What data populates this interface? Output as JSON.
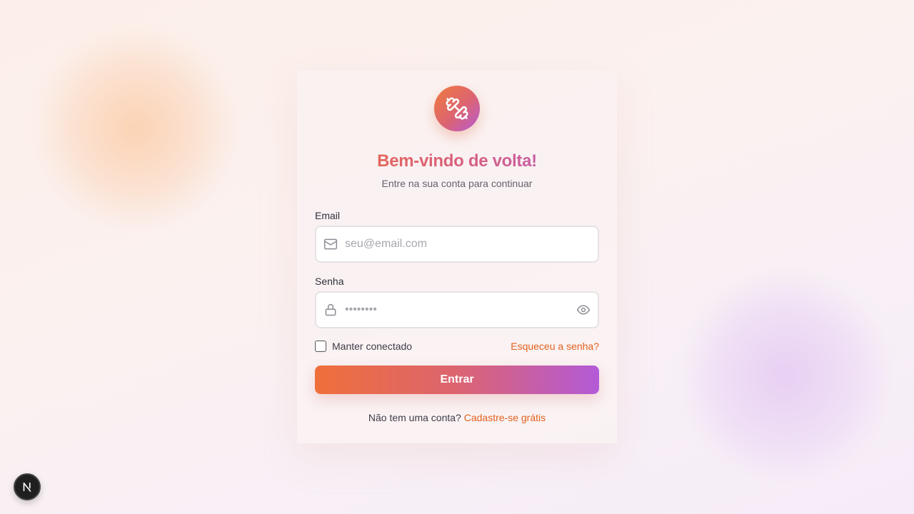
{
  "brand": {
    "icon": "dumbbell-icon",
    "accent_start": "#ef6f3a",
    "accent_end": "#b35ad8",
    "link_color": "#e4611e"
  },
  "login": {
    "title": "Bem-vindo de volta!",
    "subtitle": "Entre na sua conta para continuar",
    "email": {
      "label": "Email",
      "placeholder": "seu@email.com",
      "value": "",
      "icon": "mail-icon"
    },
    "password": {
      "label": "Senha",
      "placeholder": "••••••••",
      "value": "",
      "icon": "lock-icon",
      "toggle_icon": "eye-icon"
    },
    "remember_label": "Manter conectado",
    "remember_checked": false,
    "forgot_label": "Esqueceu a senha?",
    "submit_label": "Entrar",
    "signup_prompt": "Não tem uma conta?",
    "signup_link": "Cadastre-se grátis"
  },
  "dev_badge": {
    "label": "N",
    "icon": "nextjs-icon"
  }
}
